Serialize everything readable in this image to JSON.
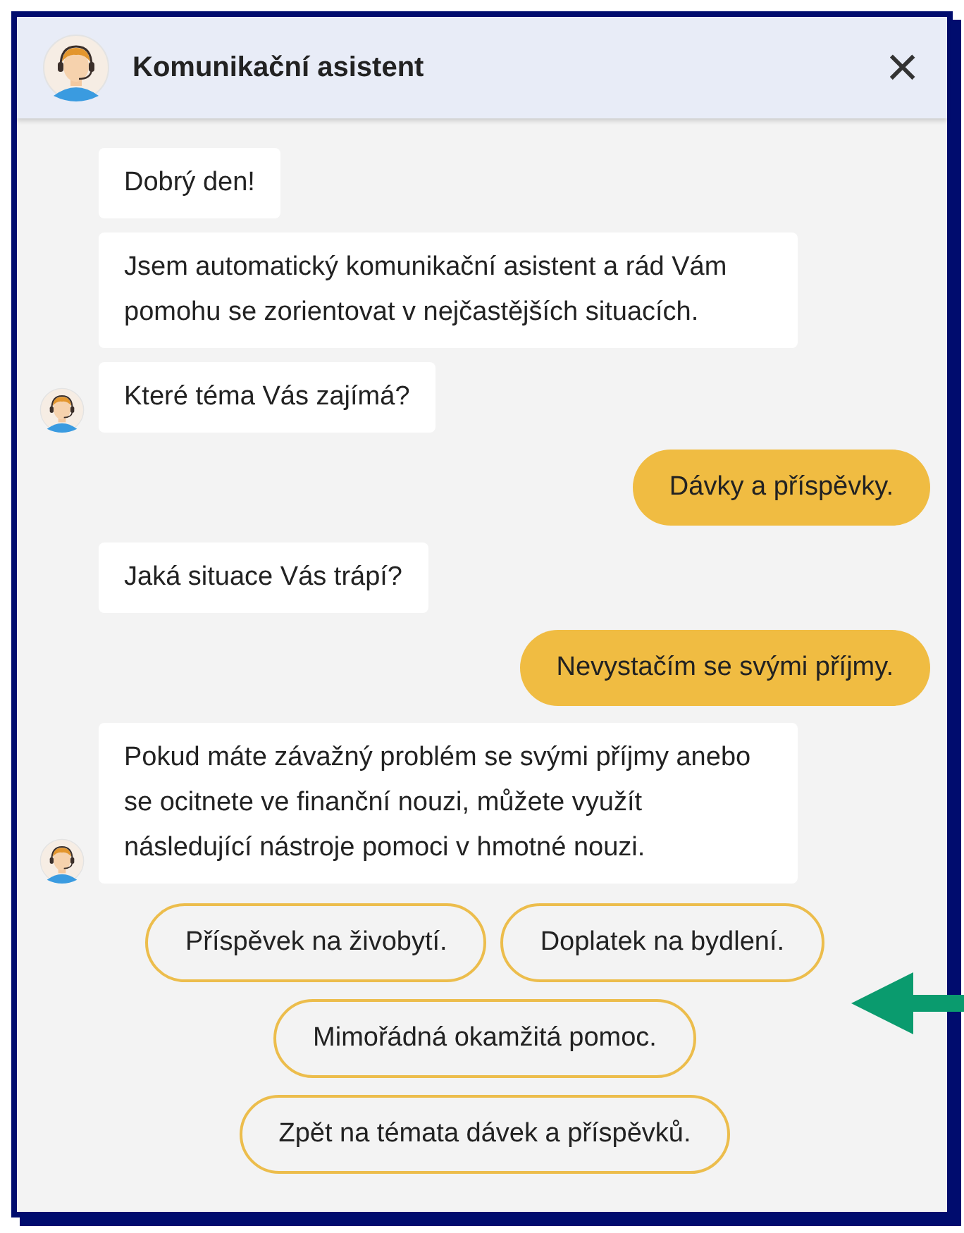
{
  "header": {
    "title": "Komunikační asistent",
    "close": "×"
  },
  "messages": [
    {
      "kind": "bot",
      "text": "Dobrý den!",
      "avatar": false
    },
    {
      "kind": "bot",
      "text": "Jsem automatický komunikační asistent a rád Vám pomohu se zorientovat v nejčastějších situacích.",
      "avatar": false
    },
    {
      "kind": "bot",
      "text": "Které téma Vás zajímá?",
      "avatar": true
    },
    {
      "kind": "user",
      "text": "Dávky a příspěvky."
    },
    {
      "kind": "bot",
      "text": "Jaká situace Vás trápí?",
      "avatar": false
    },
    {
      "kind": "user",
      "text": "Nevystačím se svými příjmy."
    },
    {
      "kind": "bot",
      "text": "Pokud máte závažný problém se svými příjmy anebo se ocitnete ve finanční nouzi, můžete využít následující nástroje pomoci v hmotné nouzi.",
      "avatar": true
    }
  ],
  "options": [
    "Příspěvek na živobytí.",
    "Doplatek na bydlení.",
    "Mimořádná okamžitá pomoc.",
    "Zpět na témata dávek a příspěvků."
  ]
}
